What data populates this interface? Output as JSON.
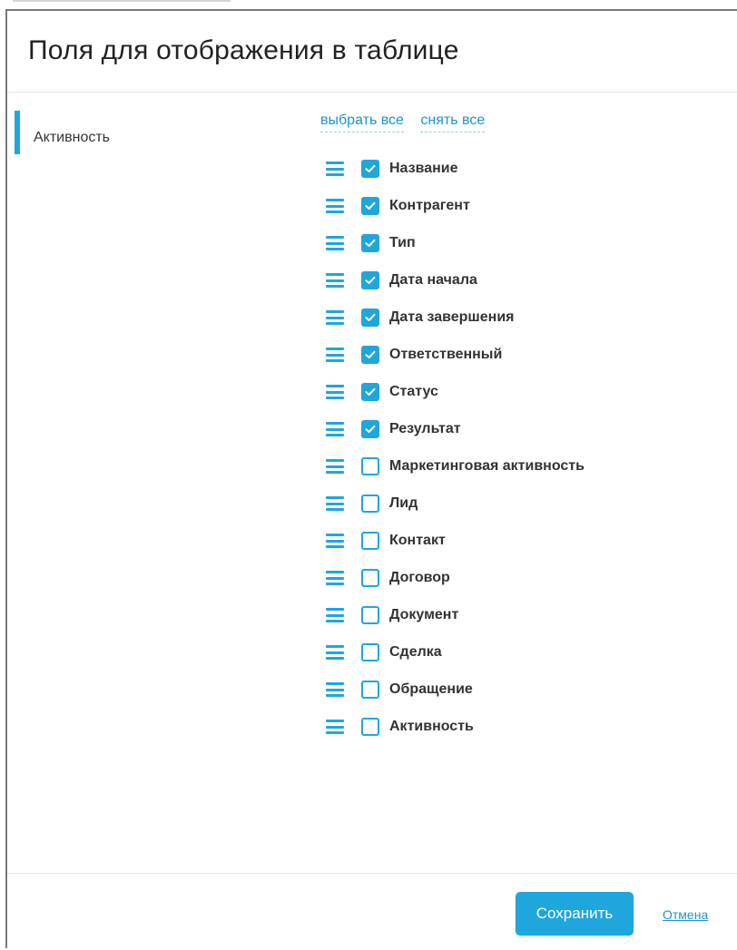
{
  "dialog": {
    "title": "Поля для отображения в таблице"
  },
  "sidebar": {
    "items": [
      {
        "label": "Активность",
        "active": true
      }
    ]
  },
  "actions": {
    "select_all": "выбрать все",
    "deselect_all": "снять все"
  },
  "fields": [
    {
      "label": "Название",
      "checked": true
    },
    {
      "label": "Контрагент",
      "checked": true
    },
    {
      "label": "Тип",
      "checked": true
    },
    {
      "label": "Дата начала",
      "checked": true
    },
    {
      "label": "Дата завершения",
      "checked": true
    },
    {
      "label": "Ответственный",
      "checked": true
    },
    {
      "label": "Статус",
      "checked": true
    },
    {
      "label": "Результат",
      "checked": true
    },
    {
      "label": "Маркетинговая активность",
      "checked": false
    },
    {
      "label": "Лид",
      "checked": false
    },
    {
      "label": "Контакт",
      "checked": false
    },
    {
      "label": "Договор",
      "checked": false
    },
    {
      "label": "Документ",
      "checked": false
    },
    {
      "label": "Сделка",
      "checked": false
    },
    {
      "label": "Обращение",
      "checked": false
    },
    {
      "label": "Активность",
      "checked": false
    }
  ],
  "footer": {
    "save_label": "Сохранить",
    "cancel_label": "Отмена"
  },
  "colors": {
    "accent": "#1fa6dc",
    "link": "#1c94d2"
  },
  "icons": {
    "drag": "drag-handle-icon",
    "check": "checkmark-icon"
  }
}
